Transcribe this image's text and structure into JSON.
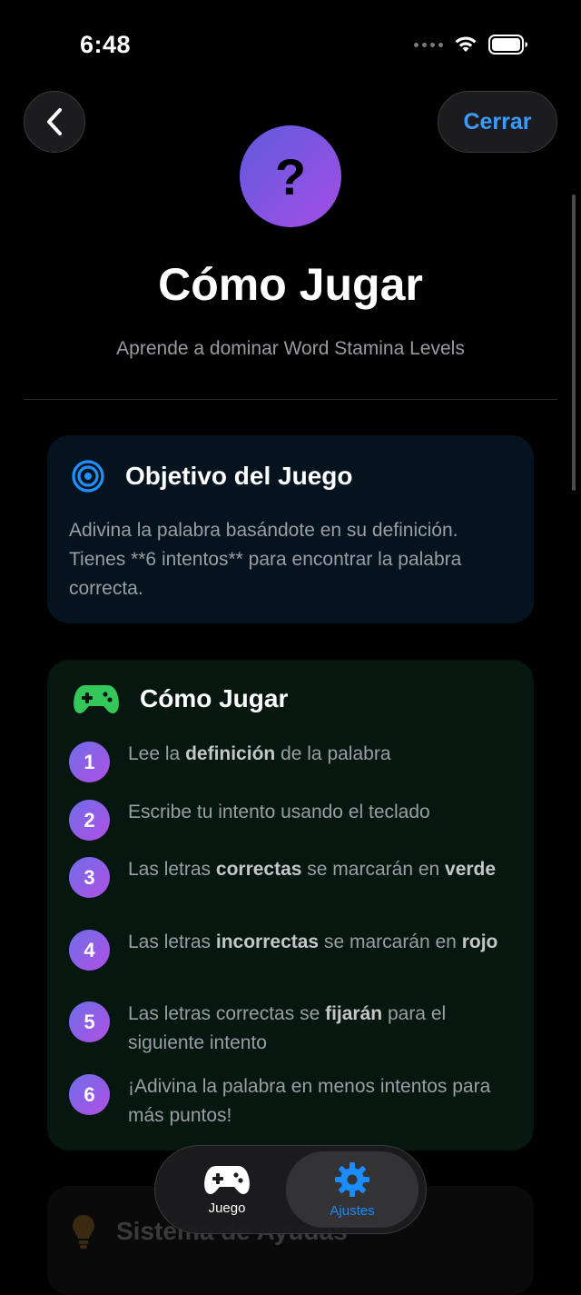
{
  "status_bar": {
    "time": "6:48"
  },
  "nav": {
    "close_label": "Cerrar"
  },
  "header": {
    "icon_glyph": "?",
    "title": "Cómo Jugar",
    "subtitle": "Aprende a dominar Word Stamina Levels"
  },
  "objective": {
    "title": "Objetivo del Juego",
    "text": "Adivina la palabra basándote en su definición. Tienes **6 intentos** para encontrar la palabra correcta.",
    "icon": "target-icon",
    "icon_color": "#1e90ff"
  },
  "how_to_play": {
    "title": "Cómo Jugar",
    "icon": "gamepad-icon",
    "icon_color": "#34c759",
    "steps": [
      {
        "num": "1",
        "parts": [
          "Lee la ",
          "definición",
          " de la palabra"
        ]
      },
      {
        "num": "2",
        "parts": [
          "Escribe tu intento usando el teclado"
        ]
      },
      {
        "num": "3",
        "parts": [
          "Las letras ",
          "correctas",
          " se marcarán en ",
          "verde"
        ]
      },
      {
        "num": "4",
        "parts": [
          "Las letras ",
          "incorrectas",
          " se marcarán en ",
          "rojo"
        ]
      },
      {
        "num": "5",
        "parts": [
          "Las letras correctas se ",
          "fijarán",
          " para el siguiente intento"
        ]
      },
      {
        "num": "6",
        "parts": [
          "¡Adivina la palabra en menos intentos para más puntos!"
        ]
      }
    ]
  },
  "hints": {
    "title": "Sistema de Ayudas",
    "icon": "lightbulb-icon"
  },
  "tab_bar": {
    "juego_label": "Juego",
    "ajustes_label": "Ajustes",
    "active": "Ajustes",
    "active_color": "#1a8cff"
  }
}
